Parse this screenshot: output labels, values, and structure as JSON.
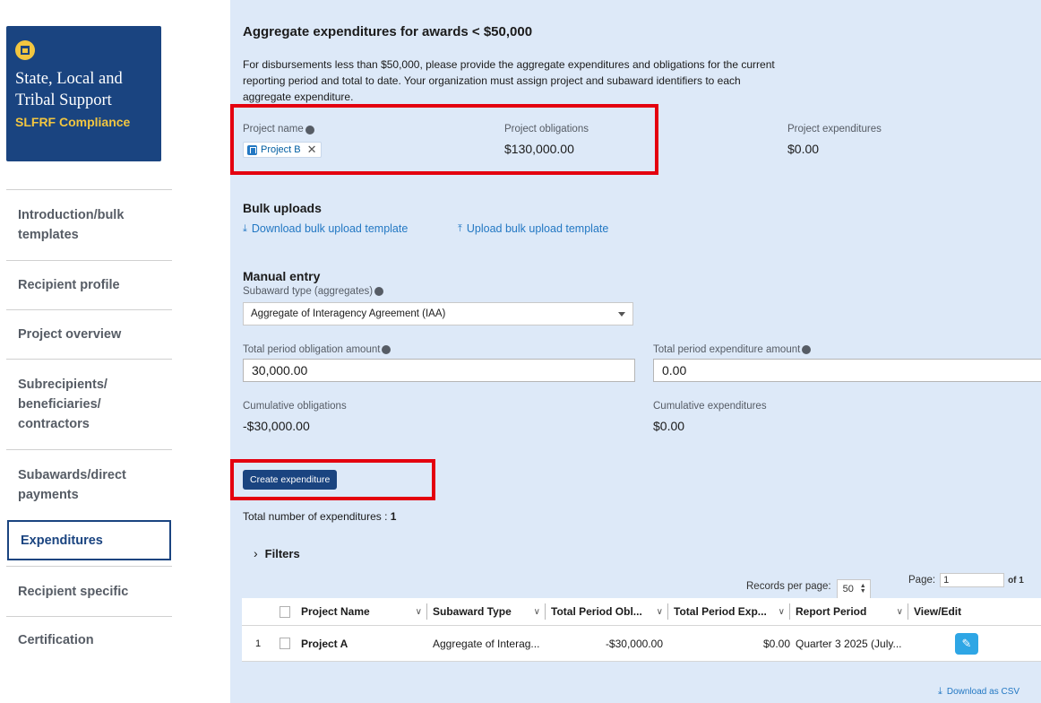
{
  "sidebar": {
    "logo": {
      "title": "State, Local and Tribal Support",
      "subtitle": "SLFRF Compliance"
    },
    "items": [
      {
        "label": "Introduction/bulk templates",
        "active": false
      },
      {
        "label": "Recipient profile",
        "active": false
      },
      {
        "label": "Project overview",
        "active": false
      },
      {
        "label": "Subrecipients/ beneficiaries/ contractors",
        "active": false
      },
      {
        "label": "Subawards/direct payments",
        "active": false
      },
      {
        "label": "Expenditures",
        "active": true
      },
      {
        "label": "Recipient specific",
        "active": false
      },
      {
        "label": "Certification",
        "active": false
      }
    ]
  },
  "main": {
    "title": "Aggregate expenditures for awards < $50,000",
    "description": "For disbursements less than $50,000, please provide the aggregate expenditures and obligations for the current reporting period and total to date. Your organization must assign project and subaward identifiers to each aggregate expenditure.",
    "project_name_label": "Project name",
    "project_chip": "Project B",
    "project_obligations_label": "Project obligations",
    "project_obligations_value": "$130,000.00",
    "project_expenditures_label": "Project expenditures",
    "project_expenditures_value": "$0.00",
    "bulk_title": "Bulk uploads",
    "download_template": "Download bulk upload template",
    "upload_template": "Upload bulk upload template",
    "manual_title": "Manual entry",
    "subaward_type_label": "Subaward type (aggregates)",
    "subaward_type_value": "Aggregate of Interagency Agreement (IAA)",
    "total_obligation_label": "Total period obligation amount",
    "total_obligation_value": "30,000.00",
    "total_expenditure_label": "Total period expenditure amount",
    "total_expenditure_value": "0.00",
    "cumulative_obligations_label": "Cumulative obligations",
    "cumulative_obligations_value": "-$30,000.00",
    "cumulative_expenditures_label": "Cumulative expenditures",
    "cumulative_expenditures_value": "$0.00",
    "create_button": "Create expenditure",
    "total_count_label": "Total number of expenditures : ",
    "total_count_value": "1",
    "filters_label": "Filters",
    "records_per_page_label": "Records per page:",
    "records_per_page_value": "50",
    "page_label": "Page:",
    "page_value": "1",
    "page_of": "of 1",
    "download_csv": "Download as CSV"
  },
  "table": {
    "columns": [
      "Project Name",
      "Subaward Type",
      "Total Period Obl...",
      "Total Period Exp...",
      "Report Period",
      "View/Edit"
    ],
    "rows": [
      {
        "index": "1",
        "project_name": "Project A",
        "subaward_type": "Aggregate of Interag...",
        "total_obligation": "-$30,000.00",
        "total_expenditure": "$0.00",
        "report_period": "Quarter 3 2025 (July..."
      }
    ]
  },
  "colors": {
    "brand_navy": "#1a4480",
    "gold": "#f2c640",
    "panel_bg": "#dde9f8",
    "link": "#2378c3",
    "highlight_red": "#e4000f",
    "edit_button": "#2ea6e5"
  },
  "icons": [
    "shield-logo-icon",
    "info-icon",
    "project-chip-icon",
    "close-icon",
    "download-icon",
    "upload-icon",
    "chevron-down-icon",
    "chevron-right-icon",
    "pencil-icon"
  ]
}
